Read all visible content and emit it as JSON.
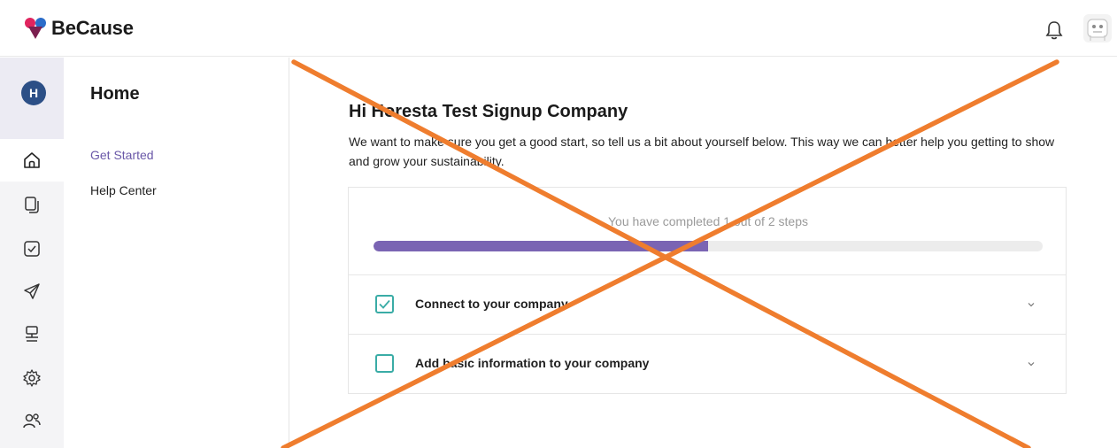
{
  "app": {
    "brand_name": "BeCause",
    "brand_colors": {
      "red": "#e0245e",
      "blue": "#2b6cc9",
      "dark": "#1a1a1a"
    }
  },
  "topbar": {
    "icons": [
      "bell-icon",
      "user-avatar"
    ]
  },
  "rail": {
    "org_initial": "H",
    "org_color": "#2c4f86",
    "icons": [
      "home-icon",
      "documents-icon",
      "tasks-icon",
      "send-icon",
      "network-icon",
      "settings-icon",
      "users-icon"
    ],
    "active_icon": "home-icon"
  },
  "subnav": {
    "title": "Home",
    "links": [
      {
        "label": "Get Started",
        "active": true
      },
      {
        "label": "Help Center",
        "active": false
      }
    ]
  },
  "main": {
    "greeting": "Hi Horesta Test Signup Company",
    "intro": "We want to make sure you get a good start, so tell us a bit about yourself below. This way we can better help you getting to show and grow your sustainability.",
    "progress": {
      "text": "You have completed 1 out of 2 steps",
      "completed": 1,
      "total": 2,
      "fill_color": "#7a64b3"
    },
    "steps": [
      {
        "label": "Connect to your company",
        "checked": true
      },
      {
        "label": "Add basic information to your company",
        "checked": false
      }
    ]
  },
  "overlay": {
    "type": "cross-out",
    "color": "#ef7d2e"
  }
}
